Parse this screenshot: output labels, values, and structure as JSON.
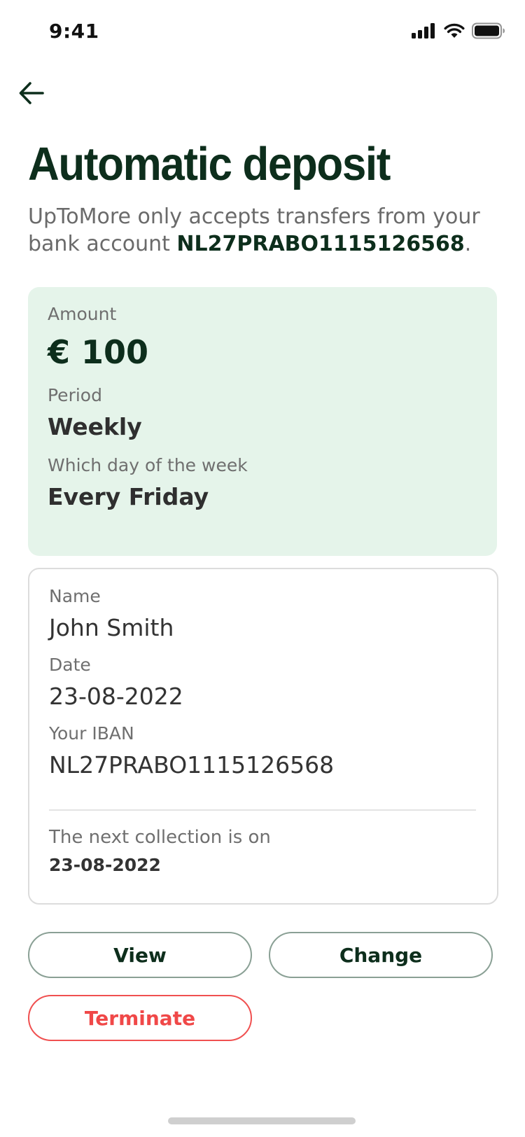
{
  "status_bar": {
    "time": "9:41"
  },
  "icons": {
    "back": "arrow-left-icon",
    "signal": "cellular-signal-icon",
    "wifi": "wifi-icon",
    "battery": "battery-icon"
  },
  "colors": {
    "primary_dark": "#0d2e1c",
    "summary_background": "#e5f4ea",
    "danger": "#f04848"
  },
  "header": {
    "title": "Automatic deposit"
  },
  "intro": {
    "text_before": "UpToMore only accepts transfers from your bank account ",
    "iban": "NL27PRABO1115126568",
    "text_after": "."
  },
  "summary": {
    "amount_label": "Amount",
    "amount_value": "€ 100",
    "period_label": "Period",
    "period_value": "Weekly",
    "day_label": "Which day of the week",
    "day_value": "Every Friday"
  },
  "details": {
    "name_label": "Name",
    "name_value": "John Smith",
    "date_label": "Date",
    "date_value": "23-08-2022",
    "iban_label": "Your IBAN",
    "iban_value": "NL27PRABO1115126568",
    "next_collection_label": "The next collection is on",
    "next_collection_date": "23-08-2022"
  },
  "actions": {
    "view_label": "View",
    "change_label": "Change",
    "terminate_label": "Terminate"
  }
}
